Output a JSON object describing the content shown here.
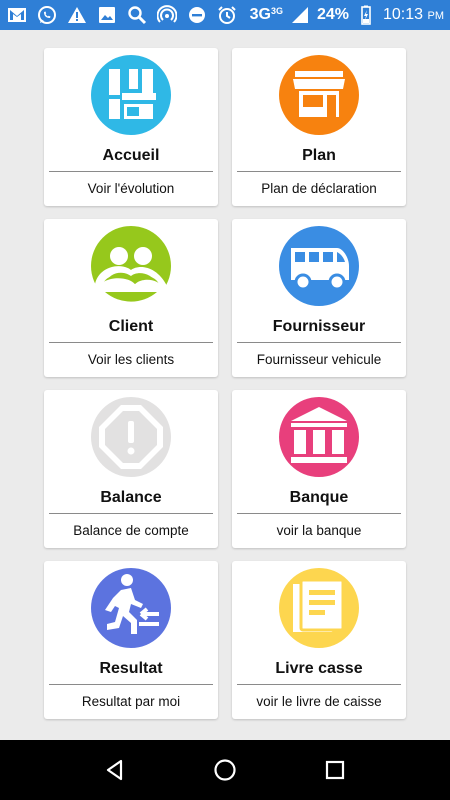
{
  "status_bar": {
    "network_label": "3G",
    "network_sup": "3G",
    "battery": "24%",
    "time": "10:13",
    "ampm": "PM",
    "icons": [
      "gmail-icon",
      "whatsapp-icon",
      "warning-icon",
      "image-icon",
      "search-icon",
      "hotspot-icon",
      "dnd-icon",
      "alarm-icon",
      "signal-icon",
      "battery-icon"
    ]
  },
  "cards": [
    {
      "title": "Accueil",
      "subtitle": "Voir l'évolution",
      "icon": "dashboard-icon",
      "color": "#2fb8e6"
    },
    {
      "title": "Plan",
      "subtitle": "Plan de déclaration",
      "icon": "store-icon",
      "color": "#f7820f"
    },
    {
      "title": "Client",
      "subtitle": "Voir les clients",
      "icon": "people-icon",
      "color": "#96c81c"
    },
    {
      "title": "Fournisseur",
      "subtitle": "Fournisseur vehicule",
      "icon": "bus-icon",
      "color": "#3a8de3"
    },
    {
      "title": "Balance",
      "subtitle": "Balance de compte",
      "icon": "alert-octagon-icon",
      "color": "#e2e1e1"
    },
    {
      "title": "Banque",
      "subtitle": "voir la banque",
      "icon": "bank-icon",
      "color": "#e83f7c"
    },
    {
      "title": "Resultat",
      "subtitle": "Resultat par moi",
      "icon": "exit-walk-icon",
      "color": "#5c73df"
    },
    {
      "title": "Livre casse",
      "subtitle": "voir le livre de caisse",
      "icon": "document-icon",
      "color": "#fdd64f"
    }
  ],
  "nav": {
    "back": "back-icon",
    "home": "home-icon",
    "recents": "recents-icon"
  }
}
